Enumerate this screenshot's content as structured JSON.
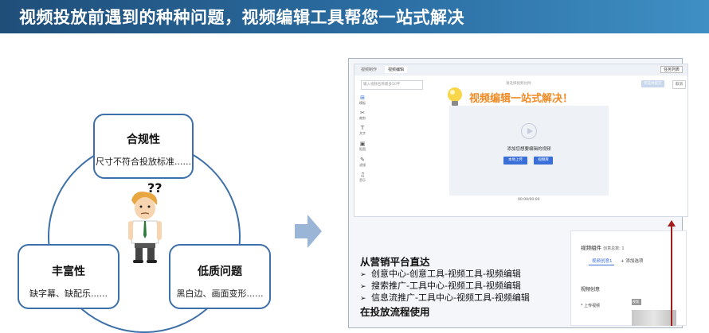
{
  "banner": {
    "title": "视频投放前遇到的种种问题，视频编辑工具帮您一站式解决"
  },
  "diagram": {
    "top": {
      "title": "合规性",
      "desc": "尺寸不符合投放标准......"
    },
    "left": {
      "title": "丰富性",
      "desc": "缺字幕、缺配乐......"
    },
    "right": {
      "title": "低质问题",
      "desc": "黑白边、画面变形......"
    },
    "question_marks": "??"
  },
  "editor": {
    "tabs": [
      "视频制作",
      "视频编辑"
    ],
    "task_button": "任务列表",
    "name_placeholder": "输入视频名称最多50字",
    "select_placeholder": "请选择视频比例",
    "finish_button": "完成并提交",
    "cancel_button": "取消",
    "tools": [
      {
        "icon": "⊞",
        "label": "模板"
      },
      {
        "icon": "✂",
        "label": "裁剪"
      },
      {
        "icon": "T",
        "label": "文字"
      },
      {
        "icon": "▣",
        "label": "贴图"
      },
      {
        "icon": "✎",
        "label": "滤镜"
      },
      {
        "icon": "♫",
        "label": "音乐"
      }
    ],
    "headline": "视频编辑一站式解决！",
    "canvas_hint": "添加您想要编辑的视频",
    "upload_button": "本地上传",
    "library_button": "视频库",
    "timecode": "00:00/00:00"
  },
  "component_panel": {
    "title": "视频组件",
    "total": "创意总数: 1",
    "tab_active": "视频创意1",
    "tab_add": "+ 添加选项",
    "section": "视频创意",
    "upload_label": "* 上传视频",
    "thumb_tag": "视频"
  },
  "text": {
    "heading1": "从营销平台直达",
    "items": [
      "创意中心-创意工具-视频工具-视频编辑",
      "搜索推广-工具中心-视频工具-视频编辑",
      "信息流推广-工具中心-视频工具-视频编辑"
    ],
    "heading2": "在投放流程使用"
  },
  "colors": {
    "accent": "#3d6fa8",
    "headline": "#f08a24",
    "arrow": "#a11d1d",
    "banner": "#2b6ea3"
  }
}
